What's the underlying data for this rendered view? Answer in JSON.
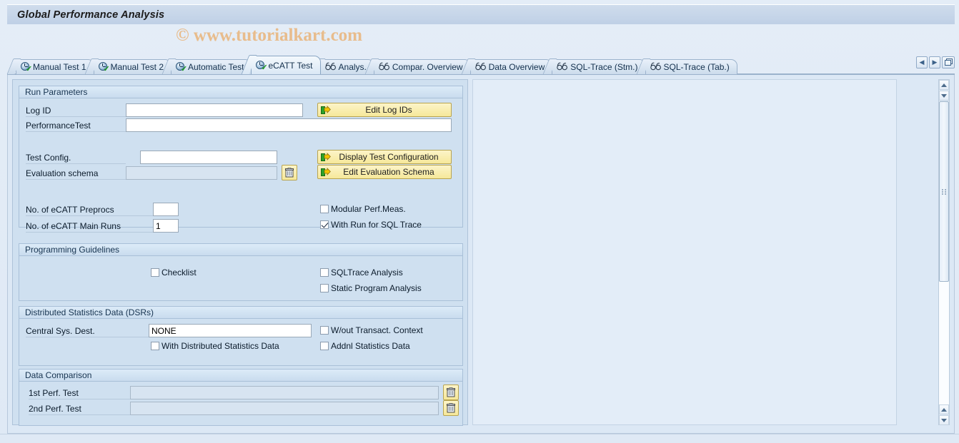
{
  "window": {
    "title": "Global Performance Analysis",
    "watermark": "© www.tutorialkart.com"
  },
  "tabstrip": {
    "tabs": [
      {
        "label": "Manual Test 1",
        "icon": "clock-check-icon",
        "active": false
      },
      {
        "label": "Manual Test 2",
        "icon": "clock-check-icon",
        "active": false
      },
      {
        "label": "Automatic Test",
        "icon": "clock-check-icon",
        "active": false
      },
      {
        "label": "eCATT Test",
        "icon": "clock-check-icon",
        "active": true
      },
      {
        "label": "Analys.",
        "icon": "glasses-icon",
        "active": false
      },
      {
        "label": "Compar. Overview",
        "icon": "glasses-icon",
        "active": false
      },
      {
        "label": "Data Overview",
        "icon": "glasses-icon",
        "active": false
      },
      {
        "label": "SQL-Trace (Stm.)",
        "icon": "glasses-icon",
        "active": false
      },
      {
        "label": "SQL-Trace (Tab.)",
        "icon": "glasses-icon",
        "active": false
      }
    ],
    "nav": {
      "prev_icon": "chevron-left-icon",
      "next_icon": "chevron-right-icon",
      "list_icon": "tab-list-icon"
    }
  },
  "run_parameters": {
    "title": "Run Parameters",
    "log_id": {
      "label": "Log ID",
      "value": "",
      "placeholder": ""
    },
    "performance_test": {
      "label": "PerformanceTest",
      "value": "",
      "placeholder": ""
    },
    "test_config": {
      "label": "Test Config.",
      "value": "",
      "placeholder": ""
    },
    "evaluation_schema": {
      "label": "Evaluation schema",
      "value": "",
      "placeholder": ""
    },
    "no_preprocs": {
      "label": "No. of eCATT Preprocs",
      "value": ""
    },
    "no_main_runs": {
      "label": "No. of eCATT Main Runs",
      "value": "1"
    },
    "buttons": {
      "edit_log_ids": "Edit Log IDs",
      "display_test_configuration": "Display Test Configuration",
      "edit_evaluation_schema": "Edit Evaluation Schema",
      "delete_evaluation_schema_icon": "trash-icon"
    },
    "checkboxes": [
      {
        "label": "Modular Perf.Meas.",
        "checked": false
      },
      {
        "label": "With Run for SQL Trace",
        "checked": true
      }
    ]
  },
  "programming_guidelines": {
    "title": "Programming Guidelines",
    "checkboxes": [
      {
        "label": "Checklist",
        "checked": false
      },
      {
        "label": "SQLTrace Analysis",
        "checked": false
      },
      {
        "label": "Static Program Analysis",
        "checked": false
      }
    ]
  },
  "distributed_statistics": {
    "title": "Distributed Statistics Data (DSRs)",
    "central_sys_dest": {
      "label": "Central Sys. Dest.",
      "value": "NONE"
    },
    "checkboxes": [
      {
        "label": "W/out Transact. Context",
        "checked": false
      },
      {
        "label": "With Distributed Statistics Data",
        "checked": false
      },
      {
        "label": "Addnl Statistics Data",
        "checked": false
      }
    ]
  },
  "data_comparison": {
    "title": "Data Comparison",
    "first_perf_test": {
      "label": "1st Perf. Test",
      "value": ""
    },
    "second_perf_test": {
      "label": "2nd Perf. Test",
      "value": ""
    },
    "delete_icon": "trash-icon"
  },
  "colors": {
    "title_bar": "#cfdcec",
    "accent_button": "#f6e89a",
    "watermark": "#e8bc8c",
    "form_bg": "#cfe0f0",
    "canvas_bg": "#dce8f5"
  }
}
